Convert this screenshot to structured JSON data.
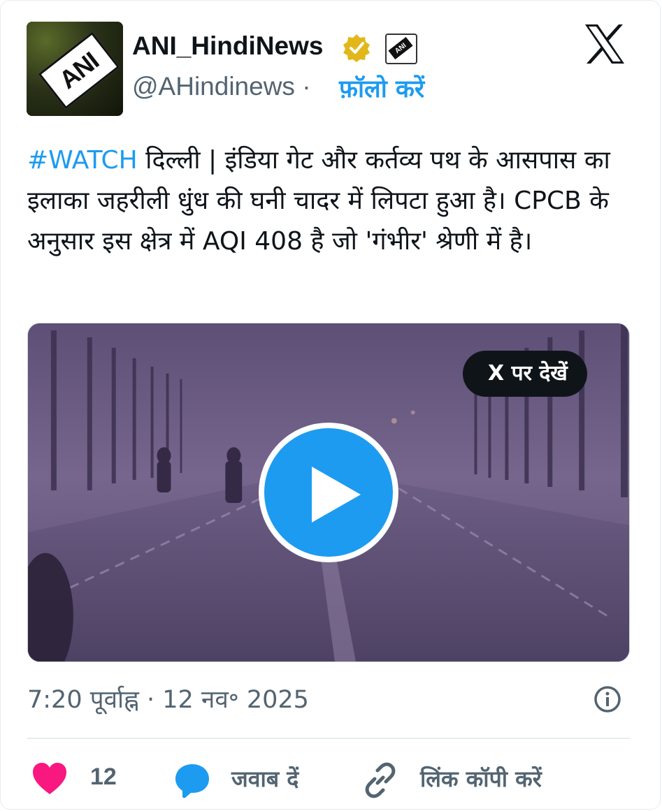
{
  "author": {
    "name": "ANI_HindiNews",
    "handle": "@AHindinews",
    "separator": "·",
    "follow_label": "फ़ॉलो करें",
    "avatar_text": "ANI"
  },
  "tweet": {
    "hashtag": "#WATCH",
    "text": " दिल्ली | इंडिया गेट और कर्तव्य पथ के आसपास का इलाका जहरीली धुंध की घनी चादर में लिपटा हुआ है। CPCB के अनुसार इस क्षेत्र में AQI 408 है जो 'गंभीर' श्रेणी में है।"
  },
  "media": {
    "view_on_x_label": "X पर देखें"
  },
  "meta": {
    "timestamp": "7:20 पूर्वाह्न · 12 नव॰ 2025"
  },
  "actions": {
    "like_count": "12",
    "reply_label": "जवाब दें",
    "copy_link_label": "लिंक कॉपी करें"
  },
  "colors": {
    "accent": "#1d9bf0",
    "like": "#f91880",
    "secondary_text": "#536471",
    "verified_gold": "#e2b719"
  },
  "icons": [
    "x-logo-icon",
    "verified-badge-icon",
    "affiliate-logo-icon",
    "play-icon",
    "info-icon",
    "heart-icon",
    "reply-bubble-icon",
    "link-icon"
  ]
}
